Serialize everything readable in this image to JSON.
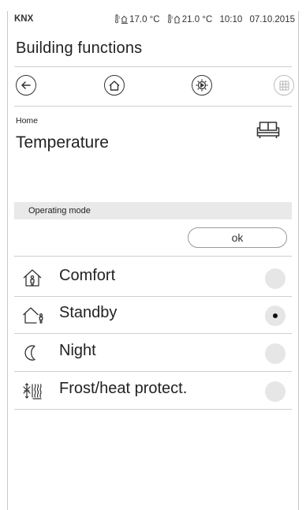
{
  "status": {
    "app": "KNX",
    "outdoor_temp": "17.0 °C",
    "indoor_temp": "21.0 °C",
    "time": "10:10",
    "date": "07.10.2015"
  },
  "header": {
    "title": "Building functions"
  },
  "nav": [
    {
      "name": "back",
      "icon": "back-arrow-icon"
    },
    {
      "name": "home",
      "icon": "home-icon"
    },
    {
      "name": "settings",
      "icon": "settings-gear-icon"
    },
    {
      "name": "grid",
      "icon": "grid-icon"
    }
  ],
  "page": {
    "breadcrumb": "Home",
    "title": "Temperature",
    "icon": "sofa-icon"
  },
  "operating_mode": {
    "header": "Operating mode",
    "ok_label": "ok",
    "selected": "Standby",
    "options": [
      {
        "label": "Comfort",
        "icon": "comfort-house-icon",
        "selected": false
      },
      {
        "label": "Standby",
        "icon": "standby-house-icon",
        "selected": true
      },
      {
        "label": "Night",
        "icon": "moon-icon",
        "selected": false
      },
      {
        "label": "Frost/heat protect.",
        "icon": "frost-heat-icon",
        "selected": false
      }
    ]
  },
  "colors": {
    "line": "#cfcfcf",
    "section_bg": "#e9e9e9",
    "radio_bg": "#e6e6e6",
    "text": "#222222"
  }
}
